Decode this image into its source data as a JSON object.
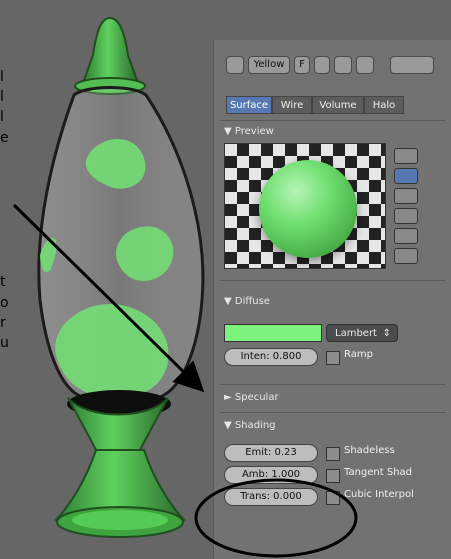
{
  "ui": {
    "header": {
      "material_name": "Yellow",
      "f_label": "F"
    },
    "tabs": [
      "Surface",
      "Wire",
      "Volume",
      "Halo"
    ],
    "active_tab": 0,
    "preview": {
      "title": "Preview"
    },
    "diffuse": {
      "title": "Diffuse",
      "shader": "Lambert",
      "intensity": "Inten: 0.800",
      "ramp": "Ramp",
      "swatch_color": "#7df27d"
    },
    "specular": {
      "title": "Specular"
    },
    "shading": {
      "title": "Shading",
      "emit": "Emit: 0.23",
      "ambient": "Amb: 1.000",
      "translucency": "Trans: 0.000",
      "shadeless": "Shadeless",
      "tangent": "Tangent Shad",
      "cubic": "Cubic Interpol"
    },
    "edge_text": [
      "l",
      "l",
      "l",
      "e",
      "t",
      "o",
      "r",
      "u"
    ]
  }
}
